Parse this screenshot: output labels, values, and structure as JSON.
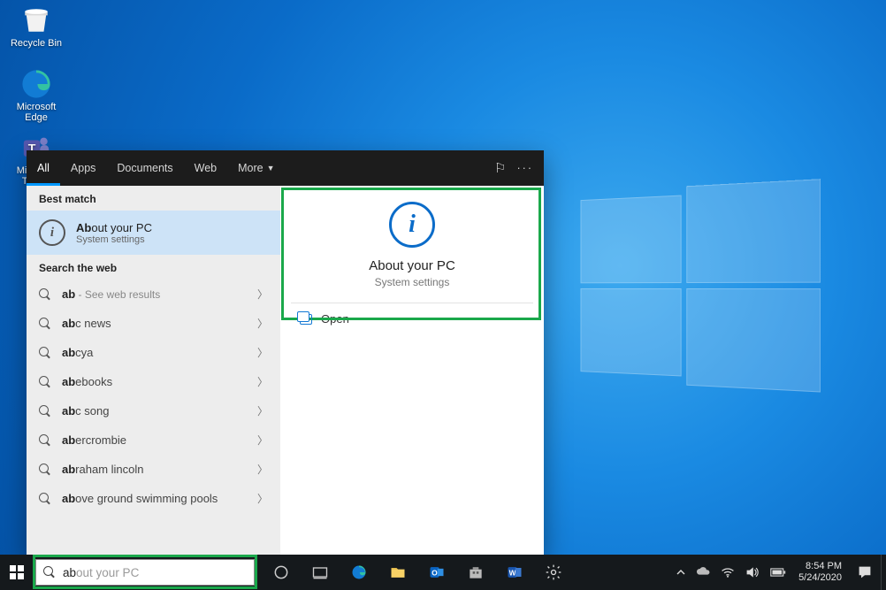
{
  "desktop_icons": {
    "recycle": "Recycle Bin",
    "edge": "Microsoft Edge",
    "teams": "Microsoft Teams"
  },
  "tabs": {
    "all": "All",
    "apps": "Apps",
    "documents": "Documents",
    "web": "Web",
    "more": "More"
  },
  "section_best": "Best match",
  "best_match": {
    "title": "About your PC",
    "sub": "System settings",
    "prefix": "Ab",
    "rest": "out your PC"
  },
  "section_web": "Search the web",
  "web_items": [
    {
      "bold": "ab",
      "rest": "",
      "hint": " - See web results"
    },
    {
      "bold": "ab",
      "rest": "c news",
      "hint": ""
    },
    {
      "bold": "ab",
      "rest": "cya",
      "hint": ""
    },
    {
      "bold": "ab",
      "rest": "ebooks",
      "hint": ""
    },
    {
      "bold": "ab",
      "rest": "c song",
      "hint": ""
    },
    {
      "bold": "ab",
      "rest": "ercrombie",
      "hint": ""
    },
    {
      "bold": "ab",
      "rest": "raham lincoln",
      "hint": ""
    },
    {
      "bold": "ab",
      "rest": "ove ground swimming pools",
      "hint": ""
    }
  ],
  "detail": {
    "title": "About your PC",
    "sub": "System settings",
    "open": "Open"
  },
  "search": {
    "typed": "ab",
    "ghost": "out your PC"
  },
  "clock": {
    "time": "8:54 PM",
    "date": "5/24/2020"
  }
}
